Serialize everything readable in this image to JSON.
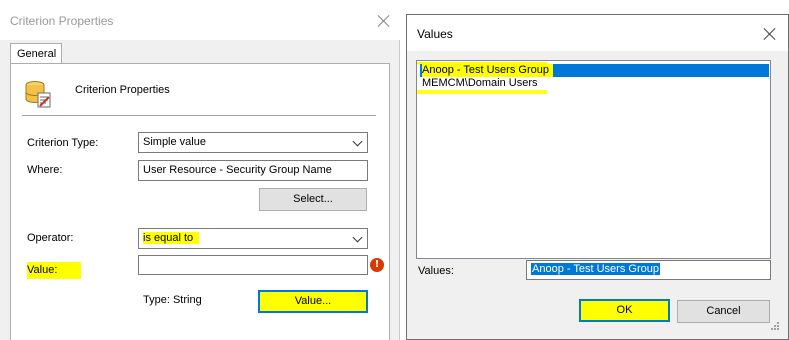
{
  "criterion_dialog": {
    "title": "Criterion Properties",
    "tab": "General",
    "section_label": "Criterion Properties",
    "criterion_type": {
      "label": "Criterion Type:",
      "value": "Simple value"
    },
    "where": {
      "label": "Where:",
      "value": "User Resource - Security Group Name"
    },
    "select_button": "Select...",
    "operator": {
      "label": "Operator:",
      "value": "is equal to"
    },
    "value_field": {
      "label": "Value:",
      "value": "",
      "error_icon": "!"
    },
    "type_text": "Type: String",
    "value_button": "Value..."
  },
  "values_dialog": {
    "title": "Values",
    "list_items": [
      {
        "label": "Anoop - Test Users Group",
        "selected": true
      },
      {
        "label": "MEMCM\\Domain Users",
        "selected": false
      }
    ],
    "values_label": "Values:",
    "values_input": "Anoop - Test Users Group",
    "ok_button": "OK",
    "cancel_button": "Cancel"
  },
  "colors": {
    "highlight": "#ffff00",
    "selection": "#0078d7",
    "default_button_border": "#0078d7",
    "error_icon": "#d83b01"
  }
}
